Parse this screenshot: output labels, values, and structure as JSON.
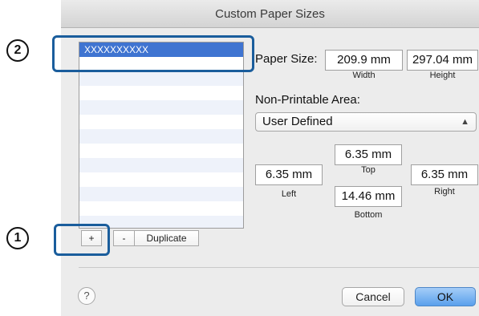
{
  "window": {
    "title": "Custom Paper Sizes"
  },
  "list": {
    "items": [
      "XXXXXXXXXX"
    ]
  },
  "list_buttons": {
    "add": "+",
    "remove": "-",
    "duplicate": "Duplicate"
  },
  "paper_size": {
    "label": "Paper Size:",
    "width": "209.9 mm",
    "height": "297.04 mm",
    "width_caption": "Width",
    "height_caption": "Height"
  },
  "non_printable": {
    "label": "Non-Printable Area:",
    "selected": "User Defined",
    "top": "6.35 mm",
    "left": "6.35 mm",
    "right": "6.35 mm",
    "bottom": "14.46 mm",
    "top_caption": "Top",
    "left_caption": "Left",
    "right_caption": "Right",
    "bottom_caption": "Bottom"
  },
  "footer": {
    "help": "?",
    "cancel": "Cancel",
    "ok": "OK"
  },
  "callouts": {
    "one": "1",
    "two": "2"
  },
  "colors": {
    "selection": "#3f74d1",
    "highlight": "#1a5d9c",
    "default_button": "#6aaef1"
  }
}
